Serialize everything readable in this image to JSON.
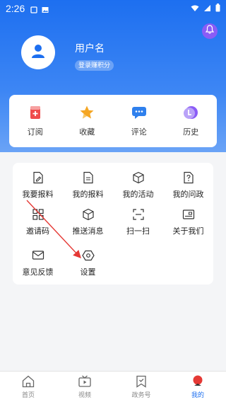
{
  "status_bar": {
    "time": "2:26"
  },
  "profile": {
    "username": "用户名",
    "points_label": "登录赚积分"
  },
  "quick_actions": [
    {
      "label": "订阅",
      "icon": "subscribe-icon"
    },
    {
      "label": "收藏",
      "icon": "star-icon"
    },
    {
      "label": "评论",
      "icon": "comment-icon"
    },
    {
      "label": "历史",
      "icon": "history-icon"
    }
  ],
  "menu": [
    {
      "label": "我要报料",
      "icon": "report-edit-icon"
    },
    {
      "label": "我的报料",
      "icon": "my-report-icon"
    },
    {
      "label": "我的活动",
      "icon": "activity-cube-icon"
    },
    {
      "label": "我的问政",
      "icon": "question-doc-icon"
    },
    {
      "label": "邀请码",
      "icon": "qr-grid-icon"
    },
    {
      "label": "推送消息",
      "icon": "push-cube-icon"
    },
    {
      "label": "扫一扫",
      "icon": "scan-icon"
    },
    {
      "label": "关于我们",
      "icon": "about-card-icon"
    },
    {
      "label": "意见反馈",
      "icon": "feedback-mail-icon"
    },
    {
      "label": "设置",
      "icon": "settings-hex-icon"
    }
  ],
  "tabs": [
    {
      "label": "首页",
      "icon": "home-icon",
      "active": false
    },
    {
      "label": "视频",
      "icon": "video-tv-icon",
      "active": false
    },
    {
      "label": "政务号",
      "icon": "bookmark-flag-icon",
      "active": false
    },
    {
      "label": "我的",
      "icon": "profile-pin-icon",
      "active": true
    }
  ],
  "colors": {
    "brand": "#1d6ff0",
    "accent_red": "#e53935"
  }
}
